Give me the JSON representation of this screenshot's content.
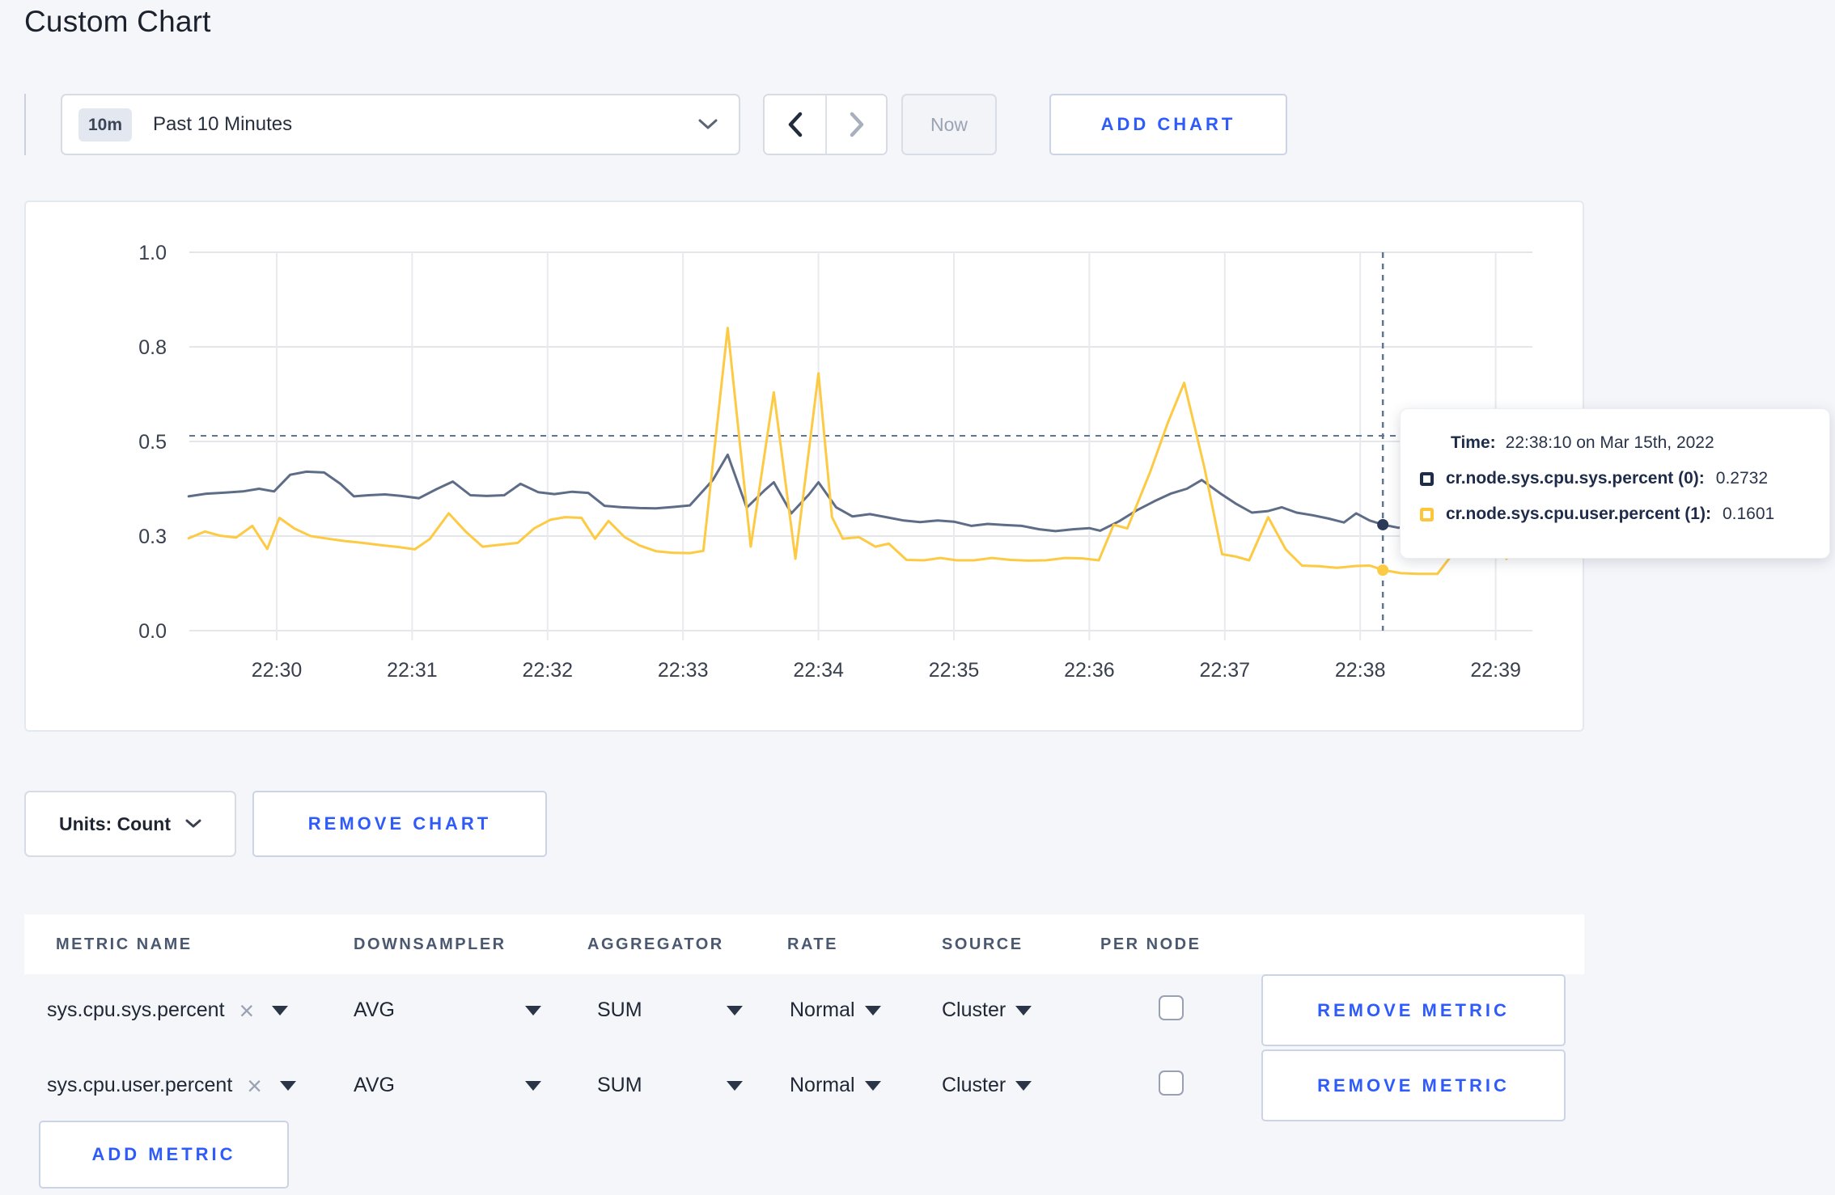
{
  "page": {
    "title": "Custom Chart"
  },
  "colors": {
    "accent_blue": "#2e5bfa",
    "navy": "#1e2b49",
    "page_background": "#f5f6fa",
    "series_sys_line": "#5e6d87",
    "series_user_line": "#fdca44",
    "crosshair": "#5f7590"
  },
  "icons": {
    "time_range_dropdown": "chevron-down-icon",
    "prev": "chevron-left-icon",
    "next": "chevron-right-icon",
    "units_dropdown": "chevron-down-icon",
    "row_clear": "x-icon",
    "row_dropdown": "caret-down-icon"
  },
  "toolbar": {
    "time_range": {
      "badge": "10m",
      "label": "Past 10 Minutes"
    },
    "now_label": "Now",
    "add_chart_label": "ADD CHART"
  },
  "chart_data": {
    "type": "line",
    "title": "",
    "xlabel": "",
    "ylabel": "",
    "grid": true,
    "legend_position": "tooltip-only",
    "x_axis": {
      "unit": "time (HH:MM)",
      "window": "minutes -0.65 to 9.27 relative to 22:30",
      "ticks": [
        {
          "label": "22:30",
          "minute": 0
        },
        {
          "label": "22:31",
          "minute": 1
        },
        {
          "label": "22:32",
          "minute": 2
        },
        {
          "label": "22:33",
          "minute": 3
        },
        {
          "label": "22:34",
          "minute": 4
        },
        {
          "label": "22:35",
          "minute": 5
        },
        {
          "label": "22:36",
          "minute": 6
        },
        {
          "label": "22:37",
          "minute": 7
        },
        {
          "label": "22:38",
          "minute": 8
        },
        {
          "label": "22:39",
          "minute": 9
        }
      ]
    },
    "y_axis": {
      "range": [
        0,
        1
      ],
      "ticks": [
        {
          "label": "0.0",
          "value": 0
        },
        {
          "label": "0.3",
          "value": 0.25
        },
        {
          "label": "0.5",
          "value": 0.5
        },
        {
          "label": "0.8",
          "value": 0.75
        },
        {
          "label": "1.0",
          "value": 1
        }
      ]
    },
    "series": [
      {
        "name": "cr.node.sys.cpu.sys.percent",
        "color": "#5e6d87",
        "points": [
          [
            -0.65,
            0.355
          ],
          [
            -0.52,
            0.362
          ],
          [
            -0.38,
            0.365
          ],
          [
            -0.25,
            0.368
          ],
          [
            -0.13,
            0.375
          ],
          [
            -0.02,
            0.368
          ],
          [
            0.1,
            0.412
          ],
          [
            0.22,
            0.42
          ],
          [
            0.35,
            0.418
          ],
          [
            0.47,
            0.388
          ],
          [
            0.57,
            0.355
          ],
          [
            0.68,
            0.358
          ],
          [
            0.8,
            0.36
          ],
          [
            0.92,
            0.356
          ],
          [
            1.05,
            0.35
          ],
          [
            1.18,
            0.374
          ],
          [
            1.3,
            0.394
          ],
          [
            1.43,
            0.358
          ],
          [
            1.55,
            0.356
          ],
          [
            1.68,
            0.358
          ],
          [
            1.8,
            0.388
          ],
          [
            1.93,
            0.366
          ],
          [
            2.05,
            0.361
          ],
          [
            2.18,
            0.367
          ],
          [
            2.3,
            0.364
          ],
          [
            2.42,
            0.33
          ],
          [
            2.55,
            0.326
          ],
          [
            2.68,
            0.324
          ],
          [
            2.8,
            0.323
          ],
          [
            2.93,
            0.327
          ],
          [
            3.05,
            0.331
          ],
          [
            3.22,
            0.398
          ],
          [
            3.33,
            0.465
          ],
          [
            3.47,
            0.325
          ],
          [
            3.6,
            0.37
          ],
          [
            3.67,
            0.392
          ],
          [
            3.8,
            0.31
          ],
          [
            3.93,
            0.36
          ],
          [
            4.0,
            0.392
          ],
          [
            4.13,
            0.326
          ],
          [
            4.25,
            0.302
          ],
          [
            4.38,
            0.308
          ],
          [
            4.5,
            0.3
          ],
          [
            4.63,
            0.291
          ],
          [
            4.75,
            0.287
          ],
          [
            4.88,
            0.291
          ],
          [
            5.0,
            0.288
          ],
          [
            5.13,
            0.277
          ],
          [
            5.25,
            0.282
          ],
          [
            5.38,
            0.279
          ],
          [
            5.5,
            0.277
          ],
          [
            5.63,
            0.268
          ],
          [
            5.75,
            0.263
          ],
          [
            5.88,
            0.268
          ],
          [
            6.0,
            0.271
          ],
          [
            6.08,
            0.264
          ],
          [
            6.22,
            0.289
          ],
          [
            6.35,
            0.318
          ],
          [
            6.48,
            0.342
          ],
          [
            6.6,
            0.362
          ],
          [
            6.72,
            0.375
          ],
          [
            6.83,
            0.398
          ],
          [
            6.97,
            0.362
          ],
          [
            7.08,
            0.336
          ],
          [
            7.2,
            0.312
          ],
          [
            7.32,
            0.316
          ],
          [
            7.42,
            0.326
          ],
          [
            7.53,
            0.312
          ],
          [
            7.65,
            0.305
          ],
          [
            7.77,
            0.296
          ],
          [
            7.88,
            0.286
          ],
          [
            7.97,
            0.31
          ],
          [
            8.07,
            0.291
          ],
          [
            8.17,
            0.28
          ],
          [
            8.28,
            0.272
          ],
          [
            8.42,
            0.278
          ],
          [
            8.55,
            0.283
          ],
          [
            8.7,
            0.279
          ],
          [
            8.85,
            0.276
          ],
          [
            9.0,
            0.279
          ],
          [
            9.13,
            0.277
          ],
          [
            9.27,
            0.283
          ]
        ]
      },
      {
        "name": "cr.node.sys.cpu.user.percent",
        "color": "#fdca44",
        "points": [
          [
            -0.65,
            0.244
          ],
          [
            -0.53,
            0.262
          ],
          [
            -0.42,
            0.251
          ],
          [
            -0.3,
            0.246
          ],
          [
            -0.18,
            0.277
          ],
          [
            -0.07,
            0.216
          ],
          [
            0.02,
            0.298
          ],
          [
            0.13,
            0.27
          ],
          [
            0.25,
            0.25
          ],
          [
            0.38,
            0.243
          ],
          [
            0.5,
            0.237
          ],
          [
            0.63,
            0.232
          ],
          [
            0.77,
            0.226
          ],
          [
            0.9,
            0.221
          ],
          [
            1.02,
            0.215
          ],
          [
            1.13,
            0.242
          ],
          [
            1.27,
            0.31
          ],
          [
            1.4,
            0.26
          ],
          [
            1.52,
            0.222
          ],
          [
            1.65,
            0.227
          ],
          [
            1.78,
            0.232
          ],
          [
            1.9,
            0.27
          ],
          [
            2.02,
            0.293
          ],
          [
            2.13,
            0.3
          ],
          [
            2.25,
            0.298
          ],
          [
            2.35,
            0.243
          ],
          [
            2.45,
            0.29
          ],
          [
            2.57,
            0.247
          ],
          [
            2.68,
            0.225
          ],
          [
            2.8,
            0.21
          ],
          [
            2.92,
            0.206
          ],
          [
            3.05,
            0.205
          ],
          [
            3.15,
            0.211
          ],
          [
            3.33,
            0.8
          ],
          [
            3.5,
            0.222
          ],
          [
            3.67,
            0.63
          ],
          [
            3.83,
            0.19
          ],
          [
            4.0,
            0.68
          ],
          [
            4.1,
            0.3
          ],
          [
            4.18,
            0.243
          ],
          [
            4.3,
            0.247
          ],
          [
            4.42,
            0.222
          ],
          [
            4.52,
            0.23
          ],
          [
            4.65,
            0.187
          ],
          [
            4.78,
            0.186
          ],
          [
            4.9,
            0.192
          ],
          [
            5.02,
            0.186
          ],
          [
            5.15,
            0.186
          ],
          [
            5.28,
            0.192
          ],
          [
            5.42,
            0.187
          ],
          [
            5.55,
            0.185
          ],
          [
            5.68,
            0.186
          ],
          [
            5.82,
            0.192
          ],
          [
            5.95,
            0.191
          ],
          [
            6.07,
            0.186
          ],
          [
            6.18,
            0.28
          ],
          [
            6.28,
            0.27
          ],
          [
            6.45,
            0.42
          ],
          [
            6.58,
            0.55
          ],
          [
            6.7,
            0.655
          ],
          [
            6.85,
            0.43
          ],
          [
            6.98,
            0.202
          ],
          [
            7.08,
            0.196
          ],
          [
            7.18,
            0.186
          ],
          [
            7.32,
            0.3
          ],
          [
            7.45,
            0.215
          ],
          [
            7.57,
            0.172
          ],
          [
            7.7,
            0.17
          ],
          [
            7.83,
            0.166
          ],
          [
            7.97,
            0.171
          ],
          [
            8.07,
            0.172
          ],
          [
            8.17,
            0.16
          ],
          [
            8.3,
            0.152
          ],
          [
            8.43,
            0.15
          ],
          [
            8.57,
            0.15
          ],
          [
            8.72,
            0.22
          ],
          [
            8.83,
            0.275
          ],
          [
            8.97,
            0.235
          ],
          [
            9.08,
            0.19
          ],
          [
            9.2,
            0.28
          ],
          [
            9.27,
            0.252
          ]
        ]
      }
    ],
    "crosshair": {
      "minute": 8.167,
      "time": "22:38:10",
      "value_line": 0.515
    },
    "hover_points": [
      {
        "series": 0,
        "minute": 8.167,
        "value": 0.28,
        "reported_value": 0.2732,
        "dot_color": "#2a3b5a"
      },
      {
        "series": 1,
        "minute": 8.167,
        "value": 0.16,
        "reported_value": 0.1601,
        "dot_color": "#fdca44"
      }
    ]
  },
  "tooltip": {
    "time_label": "Time:",
    "time_value": "22:38:10 on Mar 15th, 2022",
    "rows": [
      {
        "label": "cr.node.sys.cpu.sys.percent (0):",
        "value": "0.2732",
        "swatch_color": "#1e2b49"
      },
      {
        "label": "cr.node.sys.cpu.user.percent (1):",
        "value": "0.1601",
        "swatch_color": "#fdc53a"
      }
    ]
  },
  "units_bar": {
    "units_label": "Units: Count",
    "remove_chart_label": "REMOVE CHART"
  },
  "metrics_table": {
    "headers": [
      "METRIC NAME",
      "DOWNSAMPLER",
      "AGGREGATOR",
      "RATE",
      "SOURCE",
      "PER NODE"
    ],
    "rows": [
      {
        "metric": "sys.cpu.sys.percent",
        "downsampler": "AVG",
        "aggregator": "SUM",
        "rate": "Normal",
        "source": "Cluster",
        "per_node_checked": false,
        "remove_label": "REMOVE METRIC"
      },
      {
        "metric": "sys.cpu.user.percent",
        "downsampler": "AVG",
        "aggregator": "SUM",
        "rate": "Normal",
        "source": "Cluster",
        "per_node_checked": false,
        "remove_label": "REMOVE METRIC"
      }
    ],
    "add_metric_label": "ADD METRIC"
  }
}
